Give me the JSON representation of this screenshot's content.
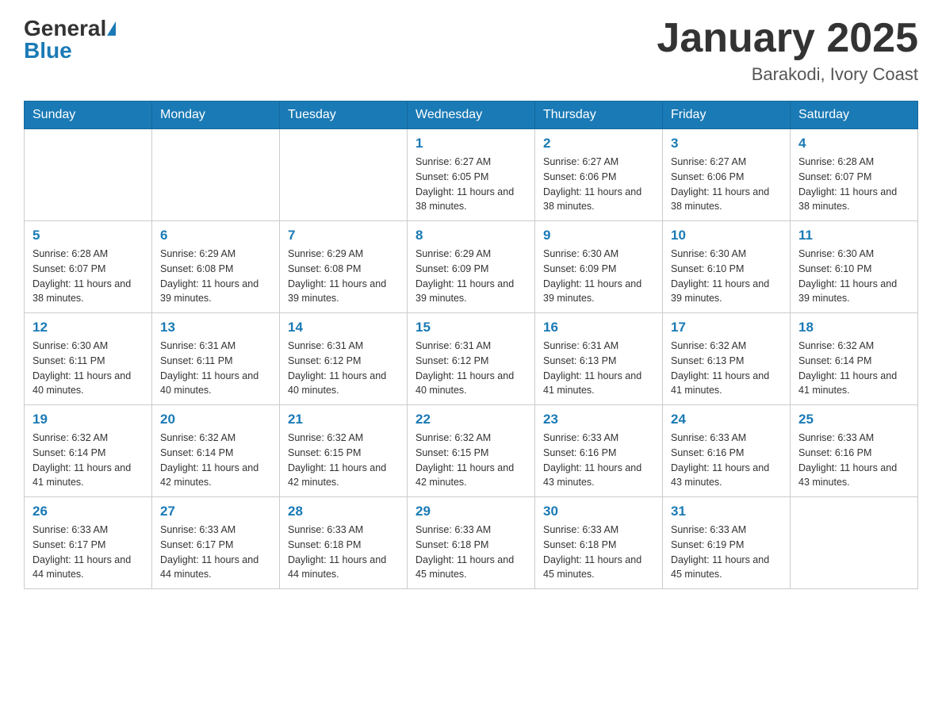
{
  "header": {
    "logo_general": "General",
    "logo_blue": "Blue",
    "month_title": "January 2025",
    "location": "Barakodi, Ivory Coast"
  },
  "calendar": {
    "days_of_week": [
      "Sunday",
      "Monday",
      "Tuesday",
      "Wednesday",
      "Thursday",
      "Friday",
      "Saturday"
    ],
    "weeks": [
      [
        {
          "day": "",
          "info": ""
        },
        {
          "day": "",
          "info": ""
        },
        {
          "day": "",
          "info": ""
        },
        {
          "day": "1",
          "info": "Sunrise: 6:27 AM\nSunset: 6:05 PM\nDaylight: 11 hours and 38 minutes."
        },
        {
          "day": "2",
          "info": "Sunrise: 6:27 AM\nSunset: 6:06 PM\nDaylight: 11 hours and 38 minutes."
        },
        {
          "day": "3",
          "info": "Sunrise: 6:27 AM\nSunset: 6:06 PM\nDaylight: 11 hours and 38 minutes."
        },
        {
          "day": "4",
          "info": "Sunrise: 6:28 AM\nSunset: 6:07 PM\nDaylight: 11 hours and 38 minutes."
        }
      ],
      [
        {
          "day": "5",
          "info": "Sunrise: 6:28 AM\nSunset: 6:07 PM\nDaylight: 11 hours and 38 minutes."
        },
        {
          "day": "6",
          "info": "Sunrise: 6:29 AM\nSunset: 6:08 PM\nDaylight: 11 hours and 39 minutes."
        },
        {
          "day": "7",
          "info": "Sunrise: 6:29 AM\nSunset: 6:08 PM\nDaylight: 11 hours and 39 minutes."
        },
        {
          "day": "8",
          "info": "Sunrise: 6:29 AM\nSunset: 6:09 PM\nDaylight: 11 hours and 39 minutes."
        },
        {
          "day": "9",
          "info": "Sunrise: 6:30 AM\nSunset: 6:09 PM\nDaylight: 11 hours and 39 minutes."
        },
        {
          "day": "10",
          "info": "Sunrise: 6:30 AM\nSunset: 6:10 PM\nDaylight: 11 hours and 39 minutes."
        },
        {
          "day": "11",
          "info": "Sunrise: 6:30 AM\nSunset: 6:10 PM\nDaylight: 11 hours and 39 minutes."
        }
      ],
      [
        {
          "day": "12",
          "info": "Sunrise: 6:30 AM\nSunset: 6:11 PM\nDaylight: 11 hours and 40 minutes."
        },
        {
          "day": "13",
          "info": "Sunrise: 6:31 AM\nSunset: 6:11 PM\nDaylight: 11 hours and 40 minutes."
        },
        {
          "day": "14",
          "info": "Sunrise: 6:31 AM\nSunset: 6:12 PM\nDaylight: 11 hours and 40 minutes."
        },
        {
          "day": "15",
          "info": "Sunrise: 6:31 AM\nSunset: 6:12 PM\nDaylight: 11 hours and 40 minutes."
        },
        {
          "day": "16",
          "info": "Sunrise: 6:31 AM\nSunset: 6:13 PM\nDaylight: 11 hours and 41 minutes."
        },
        {
          "day": "17",
          "info": "Sunrise: 6:32 AM\nSunset: 6:13 PM\nDaylight: 11 hours and 41 minutes."
        },
        {
          "day": "18",
          "info": "Sunrise: 6:32 AM\nSunset: 6:14 PM\nDaylight: 11 hours and 41 minutes."
        }
      ],
      [
        {
          "day": "19",
          "info": "Sunrise: 6:32 AM\nSunset: 6:14 PM\nDaylight: 11 hours and 41 minutes."
        },
        {
          "day": "20",
          "info": "Sunrise: 6:32 AM\nSunset: 6:14 PM\nDaylight: 11 hours and 42 minutes."
        },
        {
          "day": "21",
          "info": "Sunrise: 6:32 AM\nSunset: 6:15 PM\nDaylight: 11 hours and 42 minutes."
        },
        {
          "day": "22",
          "info": "Sunrise: 6:32 AM\nSunset: 6:15 PM\nDaylight: 11 hours and 42 minutes."
        },
        {
          "day": "23",
          "info": "Sunrise: 6:33 AM\nSunset: 6:16 PM\nDaylight: 11 hours and 43 minutes."
        },
        {
          "day": "24",
          "info": "Sunrise: 6:33 AM\nSunset: 6:16 PM\nDaylight: 11 hours and 43 minutes."
        },
        {
          "day": "25",
          "info": "Sunrise: 6:33 AM\nSunset: 6:16 PM\nDaylight: 11 hours and 43 minutes."
        }
      ],
      [
        {
          "day": "26",
          "info": "Sunrise: 6:33 AM\nSunset: 6:17 PM\nDaylight: 11 hours and 44 minutes."
        },
        {
          "day": "27",
          "info": "Sunrise: 6:33 AM\nSunset: 6:17 PM\nDaylight: 11 hours and 44 minutes."
        },
        {
          "day": "28",
          "info": "Sunrise: 6:33 AM\nSunset: 6:18 PM\nDaylight: 11 hours and 44 minutes."
        },
        {
          "day": "29",
          "info": "Sunrise: 6:33 AM\nSunset: 6:18 PM\nDaylight: 11 hours and 45 minutes."
        },
        {
          "day": "30",
          "info": "Sunrise: 6:33 AM\nSunset: 6:18 PM\nDaylight: 11 hours and 45 minutes."
        },
        {
          "day": "31",
          "info": "Sunrise: 6:33 AM\nSunset: 6:19 PM\nDaylight: 11 hours and 45 minutes."
        },
        {
          "day": "",
          "info": ""
        }
      ]
    ]
  }
}
